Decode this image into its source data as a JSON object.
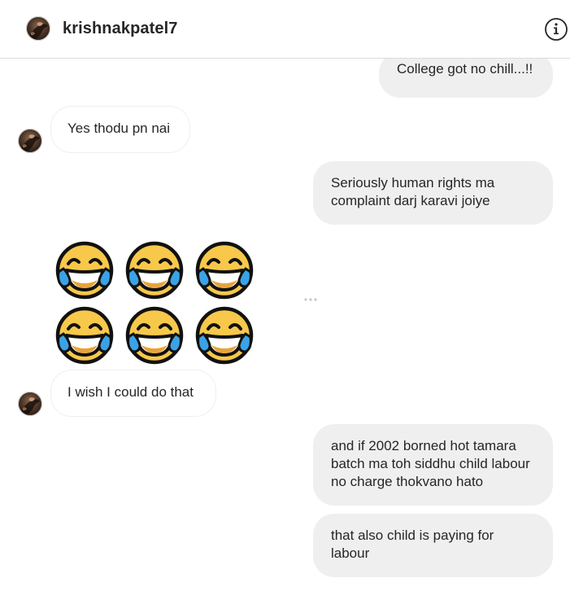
{
  "header": {
    "username": "krishnakpatel7",
    "info_icon": "info-circle-icon"
  },
  "messages": [
    {
      "side": "out",
      "text": "College got no chill...!!"
    },
    {
      "side": "in",
      "text": "Yes thodu pn nai"
    },
    {
      "side": "out",
      "text": "Seriously human rights ma complaint darj karavi joiye"
    },
    {
      "side": "out",
      "type": "emoji",
      "emoji": "face-with-tears-of-joy",
      "count": 6
    },
    {
      "side": "in",
      "text": "I wish I could do that"
    },
    {
      "side": "out",
      "text": "and if 2002 borned hot tamara batch ma toh siddhu child labour no charge thokvano hato"
    },
    {
      "side": "out",
      "text": "that also child is paying for labour"
    }
  ],
  "icons": {
    "more": "more-horizontal-icon"
  },
  "colors": {
    "outgoing_bubble": "#efefef",
    "incoming_border": "#efefef",
    "emoji_face": "#f7c84a",
    "emoji_tears": "#3aa3e6"
  }
}
